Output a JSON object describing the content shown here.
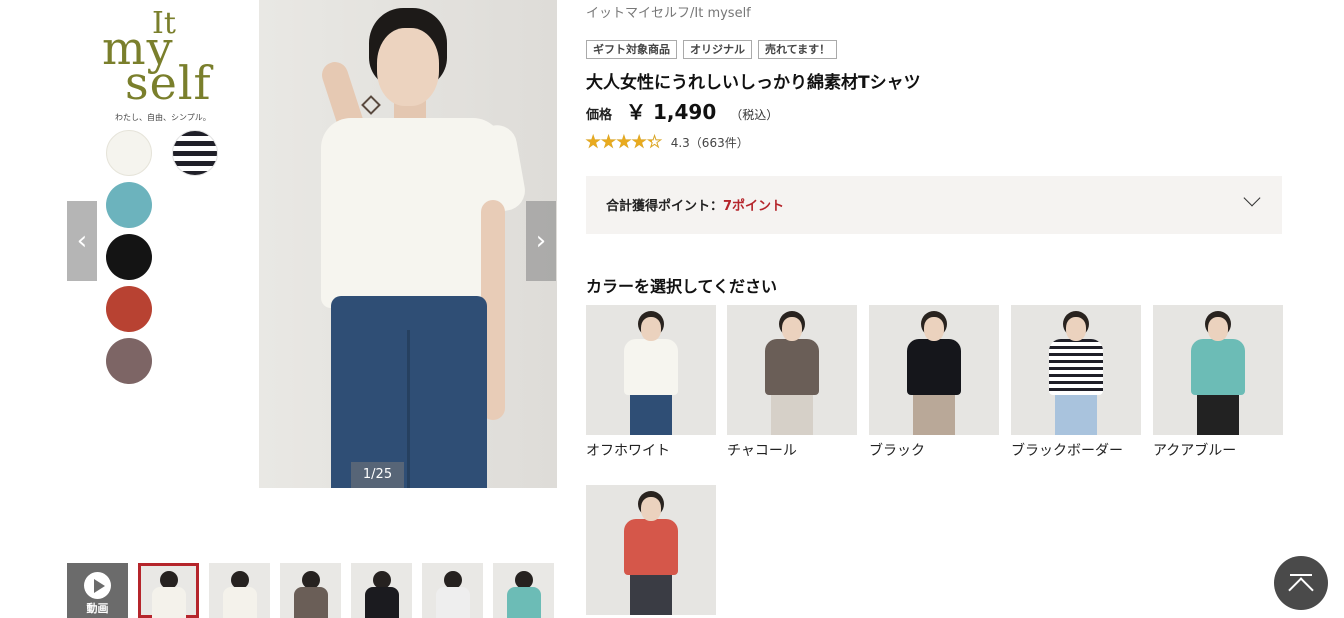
{
  "gallery": {
    "logo": {
      "it": "It",
      "my": "my",
      "self": "self",
      "tagline": "わたし、自由、シンプル。"
    },
    "swatches": [
      "offwhite",
      "black-border",
      "aqua-blue",
      "black",
      "red",
      "mocha"
    ],
    "counter": "1/25",
    "prev_icon": "‹",
    "next_icon": "›",
    "video_label": "動画",
    "thumbnail_colors": [
      "#f4f2eb",
      "#f4f2eb",
      "#6a5e57",
      "#1b1b1f",
      "#eeeeee",
      "#6cbcb6"
    ]
  },
  "product": {
    "brand": "イットマイセルフ/It myself",
    "badges": [
      "ギフト対象商品",
      "オリジナル",
      "売れてます！"
    ],
    "title": "大人女性にうれしいしっかり綿素材Tシャツ",
    "price_label": "価格",
    "price_value": "￥ 1,490",
    "price_tax": "（税込）",
    "rating_value": 4.3,
    "rating_text": "4.3（663件）",
    "stars": "★★★★★",
    "points_label": "合計獲得ポイント：",
    "points_value": "7ポイント"
  },
  "colors": {
    "heading": "カラーを選択してください",
    "items": [
      {
        "name": "オフホワイト",
        "top": "#f6f5ef",
        "bottom": "#2f4e75"
      },
      {
        "name": "チャコール",
        "top": "#6a5e57",
        "bottom": "#d6d0c8"
      },
      {
        "name": "ブラック",
        "top": "#15161b",
        "bottom": "#b9a898"
      },
      {
        "name": "ブラックボーダー",
        "top": "#ffffff",
        "bottom": "#a9c3dd"
      },
      {
        "name": "アクアブルー",
        "top": "#6cbcb6",
        "bottom": "#222222"
      },
      {
        "name": "",
        "top": "#d5574a",
        "bottom": "#3a3c44"
      }
    ]
  },
  "accent_colors": {
    "points": "#b5252b",
    "star": "#e9aa1e",
    "active_thumb": "#b5252b"
  }
}
